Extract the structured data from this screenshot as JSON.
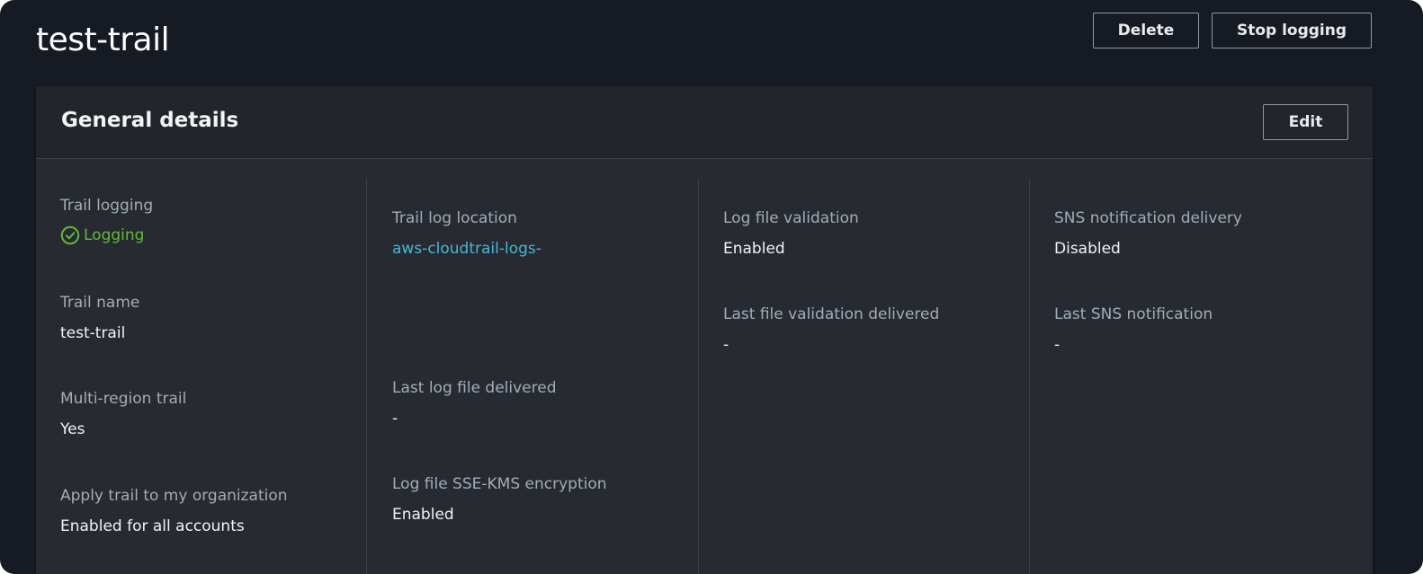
{
  "header": {
    "title": "test-trail",
    "delete_label": "Delete",
    "stop_logging_label": "Stop logging"
  },
  "general_details": {
    "title": "General details",
    "edit_label": "Edit",
    "columns": [
      [
        {
          "label": "Trail logging",
          "value": "Logging",
          "status": "success"
        },
        {
          "label": "Trail name",
          "value": "test-trail"
        },
        {
          "label": "Multi-region trail",
          "value": "Yes"
        },
        {
          "label": "Apply trail to my organization",
          "value": "Enabled for all accounts"
        }
      ],
      [
        {
          "label": "Trail log location",
          "value": "aws-cloudtrail-logs-",
          "link": true
        },
        {
          "label": "Last log file delivered",
          "value": "-"
        },
        {
          "label": "Log file SSE-KMS encryption",
          "value": "Enabled"
        }
      ],
      [
        {
          "label": "Log file validation",
          "value": "Enabled"
        },
        {
          "label": "Last file validation delivered",
          "value": "-"
        }
      ],
      [
        {
          "label": "SNS notification delivery",
          "value": "Disabled"
        },
        {
          "label": "Last SNS notification",
          "value": "-"
        }
      ]
    ]
  },
  "colors": {
    "success": "#5fbb3a",
    "link": "#44b9d6",
    "background": "#161a22",
    "panel": "#272a30"
  }
}
